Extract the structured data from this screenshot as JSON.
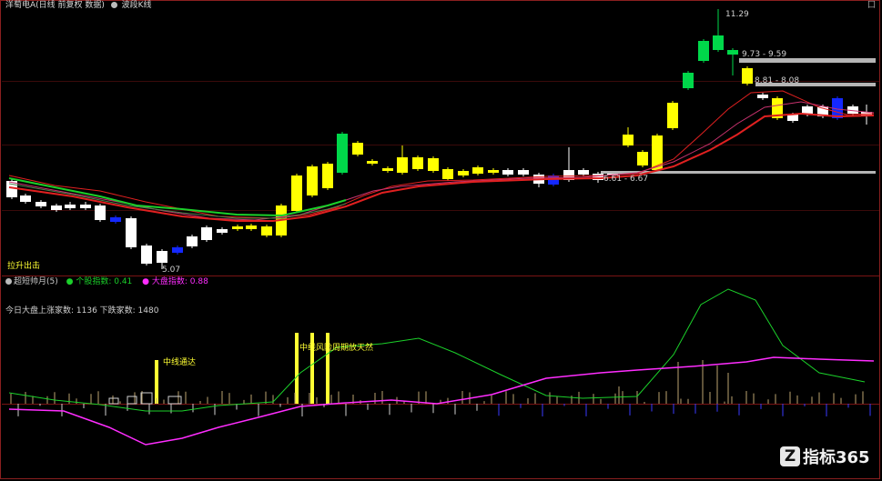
{
  "top_bar": {
    "title": "洋萄电A(日线 前复权 数据)",
    "indicator_tab": "波段K线",
    "corner_marks": [
      "囗"
    ]
  },
  "main_chart": {
    "price_labels": {
      "high": "11.29",
      "low": "5.07",
      "range_high": "9.73 - 9.59",
      "range_mid": "8.81 - 8.08",
      "range_low": "6.61 - 6.67"
    },
    "signal_text": "拉升出击"
  },
  "sub_chart": {
    "title": "超短帅月(5)",
    "legend1_label": "个股指数: 0.41",
    "legend2_label": "大盘指数: 0.88",
    "market_line": "今日大盘上涨家数: 1136 下跌家数: 1480",
    "annotation_a": "中线通达",
    "annotation_b": "中线风险周期放天然"
  },
  "watermark": {
    "brand": "指标365"
  },
  "colors": {
    "bg": "#000000",
    "up": "#ffff00",
    "up_green": "#00d84a",
    "down_white": "#ffffff",
    "down_blue": "#1428ff",
    "ma_red": "#e02020",
    "ma_green": "#1bd02a",
    "magenta": "#ff2dff"
  }
}
